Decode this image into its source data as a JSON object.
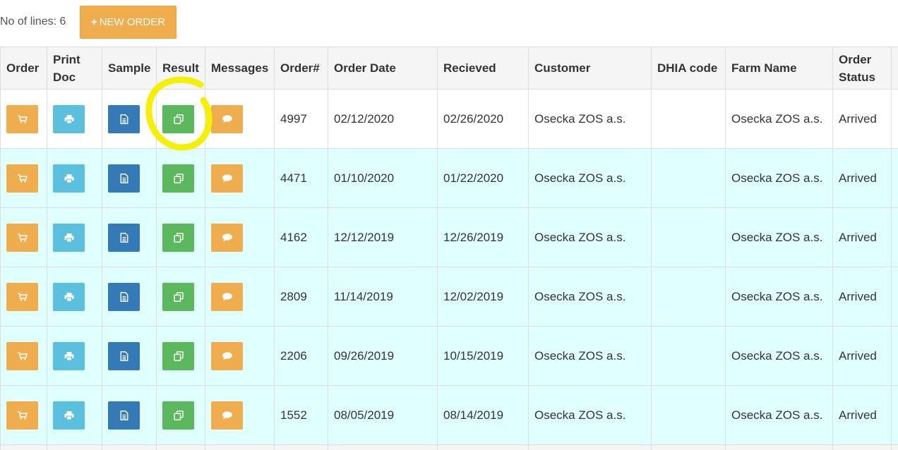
{
  "toolbar": {
    "lines_label": "No of lines: 6",
    "new_order_plus": "+",
    "new_order_label": "NEW ORDER"
  },
  "table": {
    "headers": {
      "order": "Order",
      "print_doc": "Print Doc",
      "sample": "Sample",
      "result": "Result",
      "messages": "Messages",
      "order_no": "Order#",
      "order_date": "Order Date",
      "received": "Recieved",
      "customer": "Customer",
      "dhia_code": "DHIA code",
      "farm_name": "Farm Name",
      "order_status": "Order Status"
    },
    "rows": [
      {
        "order_no": "4997",
        "order_date": "02/12/2020",
        "received": "02/26/2020",
        "customer": "Osecka ZOS a.s.",
        "dhia_code": "",
        "farm_name": "Osecka ZOS a.s.",
        "status": "Arrived"
      },
      {
        "order_no": "4471",
        "order_date": "01/10/2020",
        "received": "01/22/2020",
        "customer": "Osecka ZOS a.s.",
        "dhia_code": "",
        "farm_name": "Osecka ZOS a.s.",
        "status": "Arrived"
      },
      {
        "order_no": "4162",
        "order_date": "12/12/2019",
        "received": "12/26/2019",
        "customer": "Osecka ZOS a.s.",
        "dhia_code": "",
        "farm_name": "Osecka ZOS a.s.",
        "status": "Arrived"
      },
      {
        "order_no": "2809",
        "order_date": "11/14/2019",
        "received": "12/02/2019",
        "customer": "Osecka ZOS a.s.",
        "dhia_code": "",
        "farm_name": "Osecka ZOS a.s.",
        "status": "Arrived"
      },
      {
        "order_no": "2206",
        "order_date": "09/26/2019",
        "received": "10/15/2019",
        "customer": "Osecka ZOS a.s.",
        "dhia_code": "",
        "farm_name": "Osecka ZOS a.s.",
        "status": "Arrived"
      },
      {
        "order_no": "1552",
        "order_date": "08/05/2019",
        "received": "08/14/2019",
        "customer": "Osecka ZOS a.s.",
        "dhia_code": "",
        "farm_name": "Osecka ZOS a.s.",
        "status": "Arrived"
      }
    ]
  },
  "icons": {
    "order": "shopping-cart-icon",
    "print": "print-icon",
    "sample": "file-text-icon",
    "result": "copy-icon",
    "messages": "comment-icon"
  },
  "colors": {
    "orange": "#f0ad4e",
    "cyan_button": "#5bc0de",
    "blue_button": "#337ab7",
    "green_button": "#5cb85c",
    "row_highlight": "#e0ffff",
    "annotation": "#f5ef00"
  }
}
